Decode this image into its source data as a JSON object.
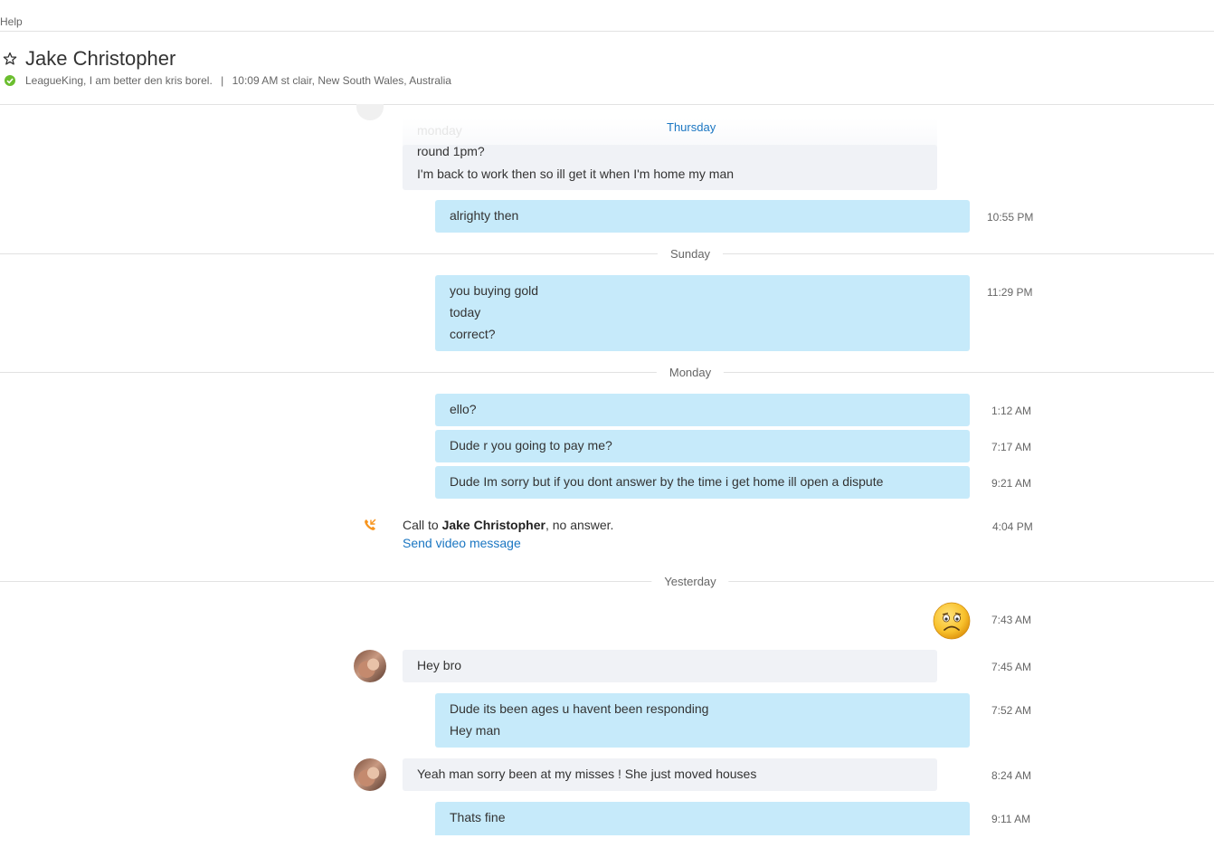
{
  "menu": {
    "help": "Help"
  },
  "header": {
    "contact_name": "Jake Christopher",
    "status_message": "LeagueKing, I am better den kris borel.",
    "separator": "|",
    "local_info": "10:09 AM st clair, New South Wales, Australia"
  },
  "floating_day": {
    "label": "Thursday",
    "ghost": "monday"
  },
  "conversation": {
    "block1": {
      "lines": [
        "round 1pm?",
        "I'm back to work then so ill get it when I'm home my man"
      ]
    },
    "msg_alrighty": {
      "lines": [
        "alrighty then"
      ],
      "time": "10:55 PM"
    },
    "day_sunday": "Sunday",
    "msg_gold": {
      "lines": [
        "you buying gold",
        "today",
        "correct?"
      ],
      "time": "11:29 PM"
    },
    "day_monday": "Monday",
    "msg_ello": {
      "lines": [
        "ello?"
      ],
      "time": "1:12 AM"
    },
    "msg_pay": {
      "lines": [
        "Dude r you going to pay me?"
      ],
      "time": "7:17 AM"
    },
    "msg_dispute": {
      "lines": [
        "Dude Im sorry but if you dont answer by the time i get home ill open a dispute"
      ],
      "time": "9:21 AM"
    },
    "call": {
      "prefix": "Call to ",
      "name": "Jake Christopher",
      "suffix": ", no answer.",
      "link": "Send video message",
      "time": "4:04 PM"
    },
    "day_yesterday": "Yesterday",
    "msg_emoticon": {
      "icon": "sad-emoticon-icon",
      "time": "7:43 AM"
    },
    "msg_heybro": {
      "lines": [
        "Hey bro"
      ],
      "time": "7:45 AM"
    },
    "msg_ages": {
      "lines": [
        "Dude its been ages u havent been responding",
        "Hey man"
      ],
      "time": "7:52 AM"
    },
    "msg_misses": {
      "lines": [
        "Yeah man sorry been at my misses ! She just moved  houses"
      ],
      "time": "8:24 AM"
    },
    "msg_fine": {
      "lines": [
        "Thats fine"
      ],
      "time": "9:11 AM"
    }
  },
  "colors": {
    "incoming_bubble": "#f0f2f6",
    "outgoing_bubble": "#c6eafa",
    "link": "#1a76c2",
    "online_status": "#6bbe2f",
    "call_icon": "#f7941d"
  }
}
